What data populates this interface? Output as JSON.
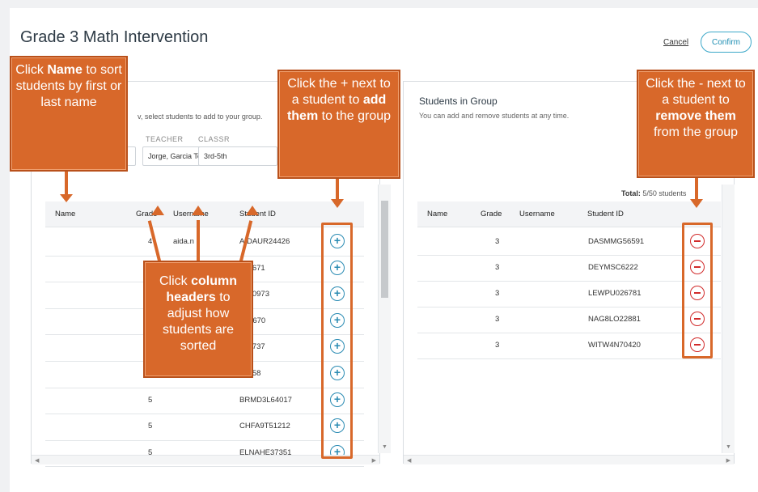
{
  "header": {
    "title": "Grade 3 Math Intervention",
    "cancel_label": "Cancel",
    "confirm_label": "Confirm"
  },
  "left_panel": {
    "instruction": "v, select students to add to your group.",
    "teacher_label": "TEACHER",
    "teacher_value": "Jorge, Garcia Tea...",
    "class_label": "CLASSR",
    "class_value": "3rd-5th",
    "columns": [
      "Name",
      "Grade",
      "Username",
      "Student ID"
    ],
    "rows": [
      {
        "grade": "4",
        "username": "aida.n",
        "student_id": "AIDAUR24426"
      },
      {
        "grade": "",
        "username": "",
        "student_id": "937671"
      },
      {
        "grade": "",
        "username": "",
        "student_id": "3L50973"
      },
      {
        "grade": "",
        "username": "",
        "student_id": "Z45670"
      },
      {
        "grade": "",
        "username": "",
        "student_id": "430737"
      },
      {
        "grade": "",
        "username": "",
        "student_id": "13258"
      },
      {
        "grade": "5",
        "username": "",
        "student_id": "BRMD3L64017"
      },
      {
        "grade": "5",
        "username": "",
        "student_id": "CHFA9T51212"
      },
      {
        "grade": "5",
        "username": "",
        "student_id": "ELNAHE37351"
      }
    ]
  },
  "right_panel": {
    "title": "Students in Group",
    "subtitle": "You can add and remove students at any time.",
    "total_label": "Total:",
    "total_value": "5/50 students",
    "columns": [
      "Name",
      "Grade",
      "Username",
      "Student ID"
    ],
    "rows": [
      {
        "grade": "3",
        "username": "",
        "student_id": "DASMMG56591"
      },
      {
        "grade": "3",
        "username": "",
        "student_id": "DEYMSC6222"
      },
      {
        "grade": "3",
        "username": "",
        "student_id": "LEWPU026781"
      },
      {
        "grade": "3",
        "username": "",
        "student_id": "NAG8LO22881"
      },
      {
        "grade": "3",
        "username": "",
        "student_id": "WITW4N70420"
      }
    ]
  },
  "callouts": {
    "name_sort_1": "Click",
    "name_sort_bold": "Name",
    "name_sort_2": "to sort students by first or last name",
    "add_1": "Click the + next to a student to",
    "add_bold": "add them",
    "add_2": "to the group",
    "remove_1": "Click the - next to a student to",
    "remove_bold": "remove them",
    "remove_2": "from the group",
    "headers_1": "Click",
    "headers_bold": "column headers",
    "headers_2": "to adjust how students are sorted"
  },
  "colors": {
    "callout": "#d8682a",
    "add_icon": "#2a8bb3",
    "remove_icon": "#d12b2b",
    "confirm_border": "#3ca8c9"
  },
  "icons": {
    "add": "plus-circle-icon",
    "remove": "minus-circle-icon",
    "dropdown": "caret-down-icon"
  }
}
